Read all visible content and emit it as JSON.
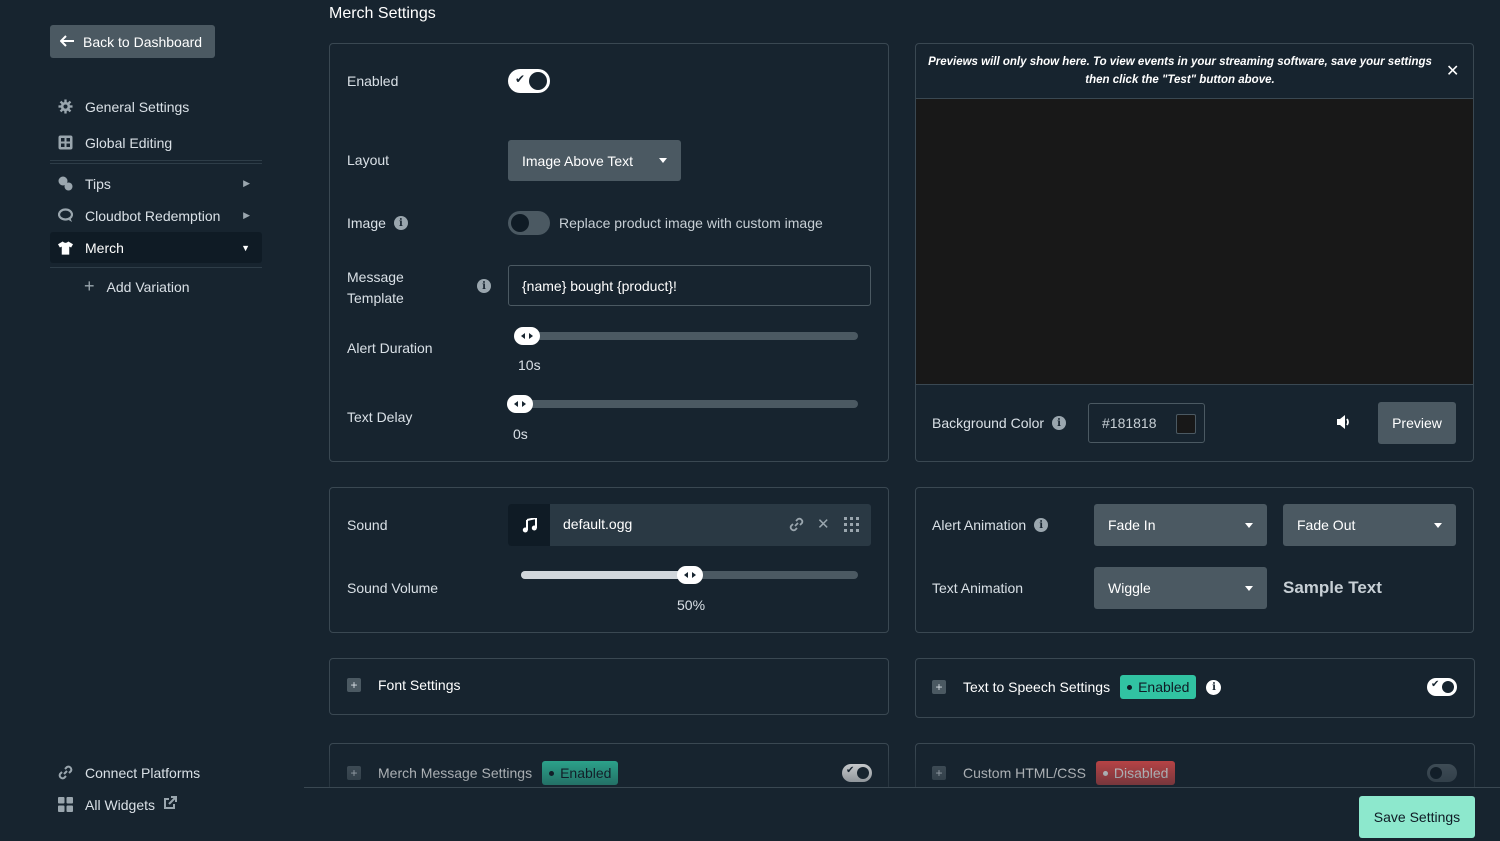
{
  "sidebar": {
    "back_label": "Back to Dashboard",
    "items": [
      {
        "label": "General Settings",
        "icon": "gear-icon"
      },
      {
        "label": "Global Editing",
        "icon": "grid-icon"
      },
      {
        "label": "Tips",
        "icon": "coins-icon"
      },
      {
        "label": "Cloudbot Redemption",
        "icon": "chat-icon"
      },
      {
        "label": "Merch",
        "icon": "tshirt-icon"
      }
    ],
    "add_variation": "Add Variation",
    "bottom": [
      {
        "label": "Connect Platforms",
        "icon": "link-icon"
      },
      {
        "label": "All Widgets",
        "icon": "widgets-icon"
      }
    ]
  },
  "main": {
    "title": "Merch Settings",
    "settings": {
      "enabled_label": "Enabled",
      "enabled": true,
      "layout_label": "Layout",
      "layout_value": "Image Above Text",
      "image_label": "Image",
      "image_toggle_text": "Replace product image with custom image",
      "image_toggle": false,
      "template_label": "Message Template",
      "template_value": "{name} bought {product}!",
      "duration_label": "Alert Duration",
      "duration_value": "10s",
      "duration_fraction": 0.03,
      "delay_label": "Text Delay",
      "delay_value": "0s",
      "delay_fraction": 0.0
    },
    "preview": {
      "note": "Previews will only show here. To view events in your streaming software, save your settings then click the \"Test\" button above.",
      "bg_label": "Background Color",
      "bg_value": "#181818",
      "preview_label": "Preview"
    },
    "sound": {
      "sound_label": "Sound",
      "file": "default.ogg",
      "volume_label": "Sound Volume",
      "volume_value": "50%",
      "volume_fraction": 0.5
    },
    "animation": {
      "alert_label": "Alert Animation",
      "in_value": "Fade In",
      "out_value": "Fade Out",
      "text_label": "Text Animation",
      "text_value": "Wiggle",
      "sample": "Sample Text"
    },
    "font_settings": "Font Settings",
    "tts": {
      "label": "Text to Speech Settings",
      "badge": "Enabled",
      "enabled": true
    },
    "merch_message": {
      "label": "Merch Message Settings",
      "badge": "Enabled",
      "enabled": true
    },
    "custom_html": {
      "label": "Custom HTML/CSS",
      "badge": "Disabled",
      "enabled": false
    },
    "save_label": "Save Settings"
  },
  "colors": {
    "accent": "#31c3a2",
    "danger": "#e04b4b",
    "save": "#8de8cd",
    "bg": "#17242f"
  }
}
